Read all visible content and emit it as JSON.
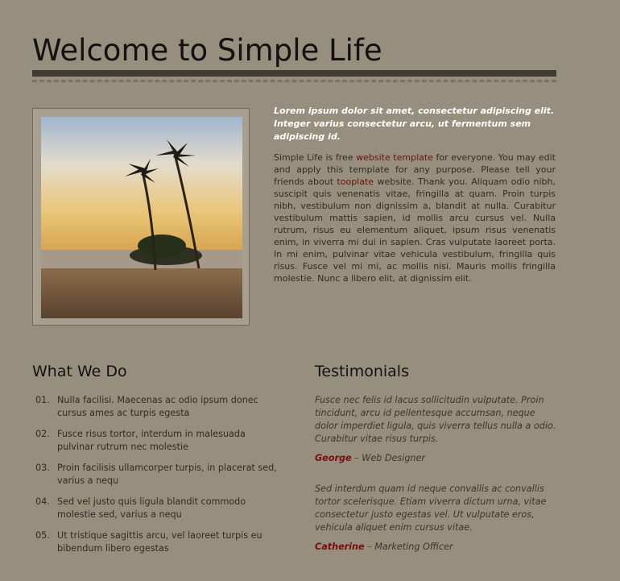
{
  "header": {
    "title": "Welcome to Simple Life"
  },
  "intro": {
    "lead": "Lorem ipsum dolor sit amet, consectetur adipiscing elit. Integer varius consectetur arcu, ut fermentum sem adipiscing id.",
    "body_part1": "Simple Life is free ",
    "link1": "website template",
    "body_part2": " for everyone. You may edit and apply this template for any purpose. Please tell your friends about ",
    "link2": "tooplate",
    "body_part3": " website. Thank you. Aliquam odio nibh, suscipit quis venenatis vitae, fringilla at quam. Proin turpis nibh, vestibulum non dignissim a, blandit at nulla. Curabitur vestibulum mattis sapien, id mollis arcu cursus vel. Nulla rutrum, risus eu elementum aliquet, ipsum risus venenatis enim, in viverra mi dui in sapien. Cras vulputate laoreet porta. In mi enim, pulvinar vitae vehicula vestibulum, fringilla quis risus. Fusce vel mi mi, ac mollis nisi. Mauris mollis fringilla molestie. Nunc a libero elit, at dignissim elit."
  },
  "what_we_do": {
    "title": "What We Do",
    "items": [
      {
        "num": "01.",
        "text": "Nulla facilisi. Maecenas ac odio ipsum donec cursus ames ac turpis egesta"
      },
      {
        "num": "02.",
        "text": "Fusce risus tortor, interdum in malesuada pulvinar rutrum nec molestie"
      },
      {
        "num": "03.",
        "text": "Proin facilisis ullamcorper turpis, in placerat sed, varius a nequ"
      },
      {
        "num": "04.",
        "text": "Sed vel justo quis ligula blandit commodo molestie sed, varius a nequ"
      },
      {
        "num": "05.",
        "text": "Ut tristique sagittis arcu, vel laoreet turpis eu bibendum libero egestas"
      }
    ]
  },
  "testimonials": {
    "title": "Testimonials",
    "items": [
      {
        "quote": "Fusce nec felis id lacus sollicitudin vulputate. Proin tincidunt, arcu id pellentesque accumsan, neque dolor imperdiet ligula, quis viverra tellus nulla a odio. Curabitur vitae risus turpis.",
        "name": "George",
        "role": " – Web Designer"
      },
      {
        "quote": "Sed interdum quam id neque convallis ac convallis tortor scelerisque. Etiam viverra dictum urna, vitae consectetur justo egestas vel. Ut vulputate eros, vehicula aliquet enim cursus vitae.",
        "name": "Catherine",
        "role": " – Marketing Officer"
      }
    ]
  },
  "colors": {
    "background": "#978f7d",
    "link": "#6b0f0f",
    "accent_name": "#7a0d0d"
  }
}
